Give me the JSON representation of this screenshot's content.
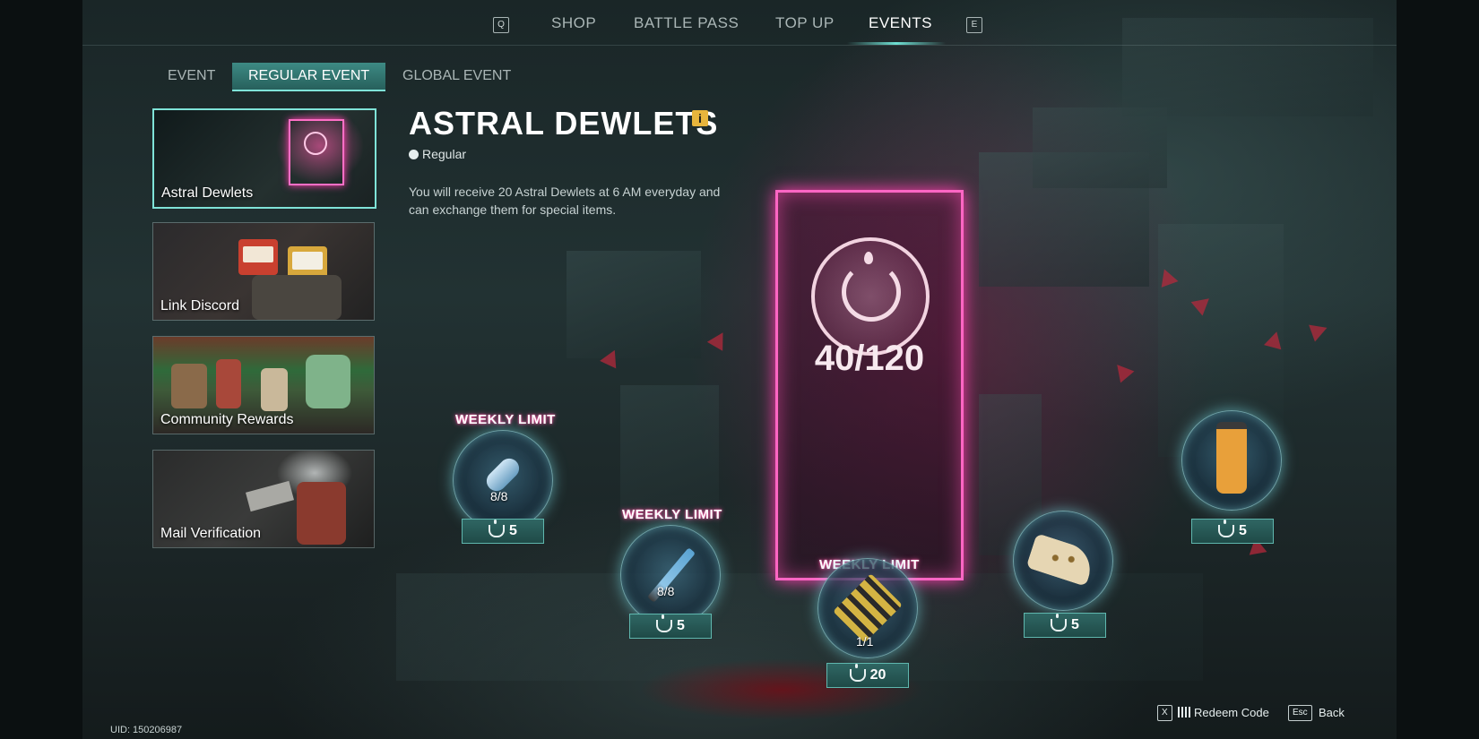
{
  "nav": {
    "left_key": "Q",
    "right_key": "E",
    "tabs": [
      "SHOP",
      "BATTLE PASS",
      "TOP UP",
      "EVENTS"
    ],
    "active_tab": "EVENTS"
  },
  "subtabs": [
    "EVENT",
    "REGULAR EVENT",
    "GLOBAL EVENT"
  ],
  "active_subtab": "REGULAR EVENT",
  "sidebar": {
    "items": [
      {
        "label": "Astral Dewlets",
        "active": true
      },
      {
        "label": "Link Discord",
        "active": false
      },
      {
        "label": "Community Rewards",
        "active": false
      },
      {
        "label": "Mail Verification",
        "active": false
      }
    ]
  },
  "event": {
    "title": "ASTRAL DEWLETS",
    "info_icon_label": "i",
    "type": "Regular",
    "description": "You will receive 20 Astral Dewlets at 6 AM everyday and can exchange them for special items.",
    "balance": "40/120"
  },
  "items": [
    {
      "name": "capsule",
      "limit_label": "WEEKLY LIMIT",
      "stock": "8/8",
      "price": "5"
    },
    {
      "name": "syringe",
      "limit_label": "WEEKLY LIMIT",
      "stock": "8/8",
      "price": "5"
    },
    {
      "name": "ammo",
      "limit_label": "WEEKLY LIMIT",
      "stock": "1/1",
      "price": "20"
    },
    {
      "name": "flatbread",
      "limit_label": "",
      "stock": "",
      "price": "5"
    },
    {
      "name": "orange-bottle",
      "limit_label": "",
      "stock": "",
      "price": "5"
    }
  ],
  "footer": {
    "uid": "UID: 150206987",
    "redeem_key": "X",
    "redeem_label": "Redeem Code",
    "back_key": "Esc",
    "back_label": "Back"
  },
  "colors": {
    "accent_teal": "#7fe3d8",
    "neon_pink": "#ff66c4",
    "info_yellow": "#e8b53c"
  }
}
